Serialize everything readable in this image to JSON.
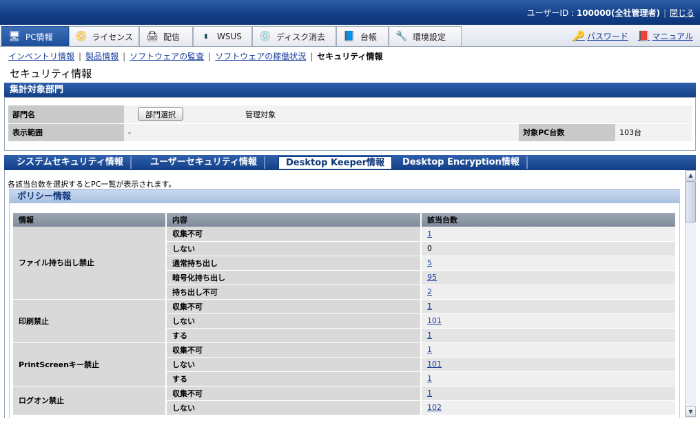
{
  "topbar": {
    "user_label": "ユーザーID : ",
    "user_value": "100000(全社管理者)",
    "logout": "閉じる"
  },
  "main_tabs": [
    {
      "label": "PC情報",
      "icon": "pc-icon"
    },
    {
      "label": "ライセンス",
      "icon": "license-icon"
    },
    {
      "label": "配信",
      "icon": "distribution-icon"
    },
    {
      "label": "WSUS",
      "icon": "wsus-icon"
    },
    {
      "label": "ディスク消去",
      "icon": "disk-erase-icon"
    },
    {
      "label": "台帳",
      "icon": "ledger-icon"
    },
    {
      "label": "環境設定",
      "icon": "settings-icon"
    }
  ],
  "tools": {
    "password": "パスワード",
    "manual": "マニュアル"
  },
  "breadcrumb": {
    "links": [
      "インベントリ情報",
      "製品情報",
      "ソフトウェアの監査",
      "ソフトウェアの稼働状況"
    ],
    "current": "セキュリティ情報"
  },
  "page_title": "セキュリティ情報",
  "dept_section": {
    "title": "集計対象部門",
    "dept_label": "部門名",
    "select_button": "部門選択",
    "dept_value": "管理対象",
    "range_label": "表示範囲",
    "range_value": "-",
    "pc_count_label": "対象PC台数",
    "pc_count_value": "103台"
  },
  "sub_tabs": [
    "システムセキュリティ情報",
    "ユーザーセキュリティ情報",
    "Desktop Keeper情報",
    "Desktop Encryption情報"
  ],
  "active_sub_tab": "Desktop Keeper情報",
  "note": "各該当台数を選択するとPC一覧が表示されます。",
  "policy": {
    "title": "ポリシー情報",
    "columns": [
      "情報",
      "内容",
      "該当台数"
    ],
    "groups": [
      {
        "info": "ファイル持ち出し禁止",
        "rows": [
          {
            "content": "収集不可",
            "count": "1",
            "link": true
          },
          {
            "content": "しない",
            "count": "0",
            "link": false
          },
          {
            "content": "通常持ち出し",
            "count": "5",
            "link": true
          },
          {
            "content": "暗号化持ち出し",
            "count": "95",
            "link": true
          },
          {
            "content": "持ち出し不可",
            "count": "2",
            "link": true
          }
        ]
      },
      {
        "info": "印刷禁止",
        "rows": [
          {
            "content": "収集不可",
            "count": "1",
            "link": true
          },
          {
            "content": "しない",
            "count": "101",
            "link": true
          },
          {
            "content": "する",
            "count": "1",
            "link": true
          }
        ]
      },
      {
        "info": "PrintScreenキー禁止",
        "rows": [
          {
            "content": "収集不可",
            "count": "1",
            "link": true
          },
          {
            "content": "しない",
            "count": "101",
            "link": true
          },
          {
            "content": "する",
            "count": "1",
            "link": true
          }
        ]
      },
      {
        "info": "ログオン禁止",
        "rows": [
          {
            "content": "収集不可",
            "count": "1",
            "link": true
          },
          {
            "content": "しない",
            "count": "102",
            "link": true
          }
        ]
      }
    ]
  }
}
